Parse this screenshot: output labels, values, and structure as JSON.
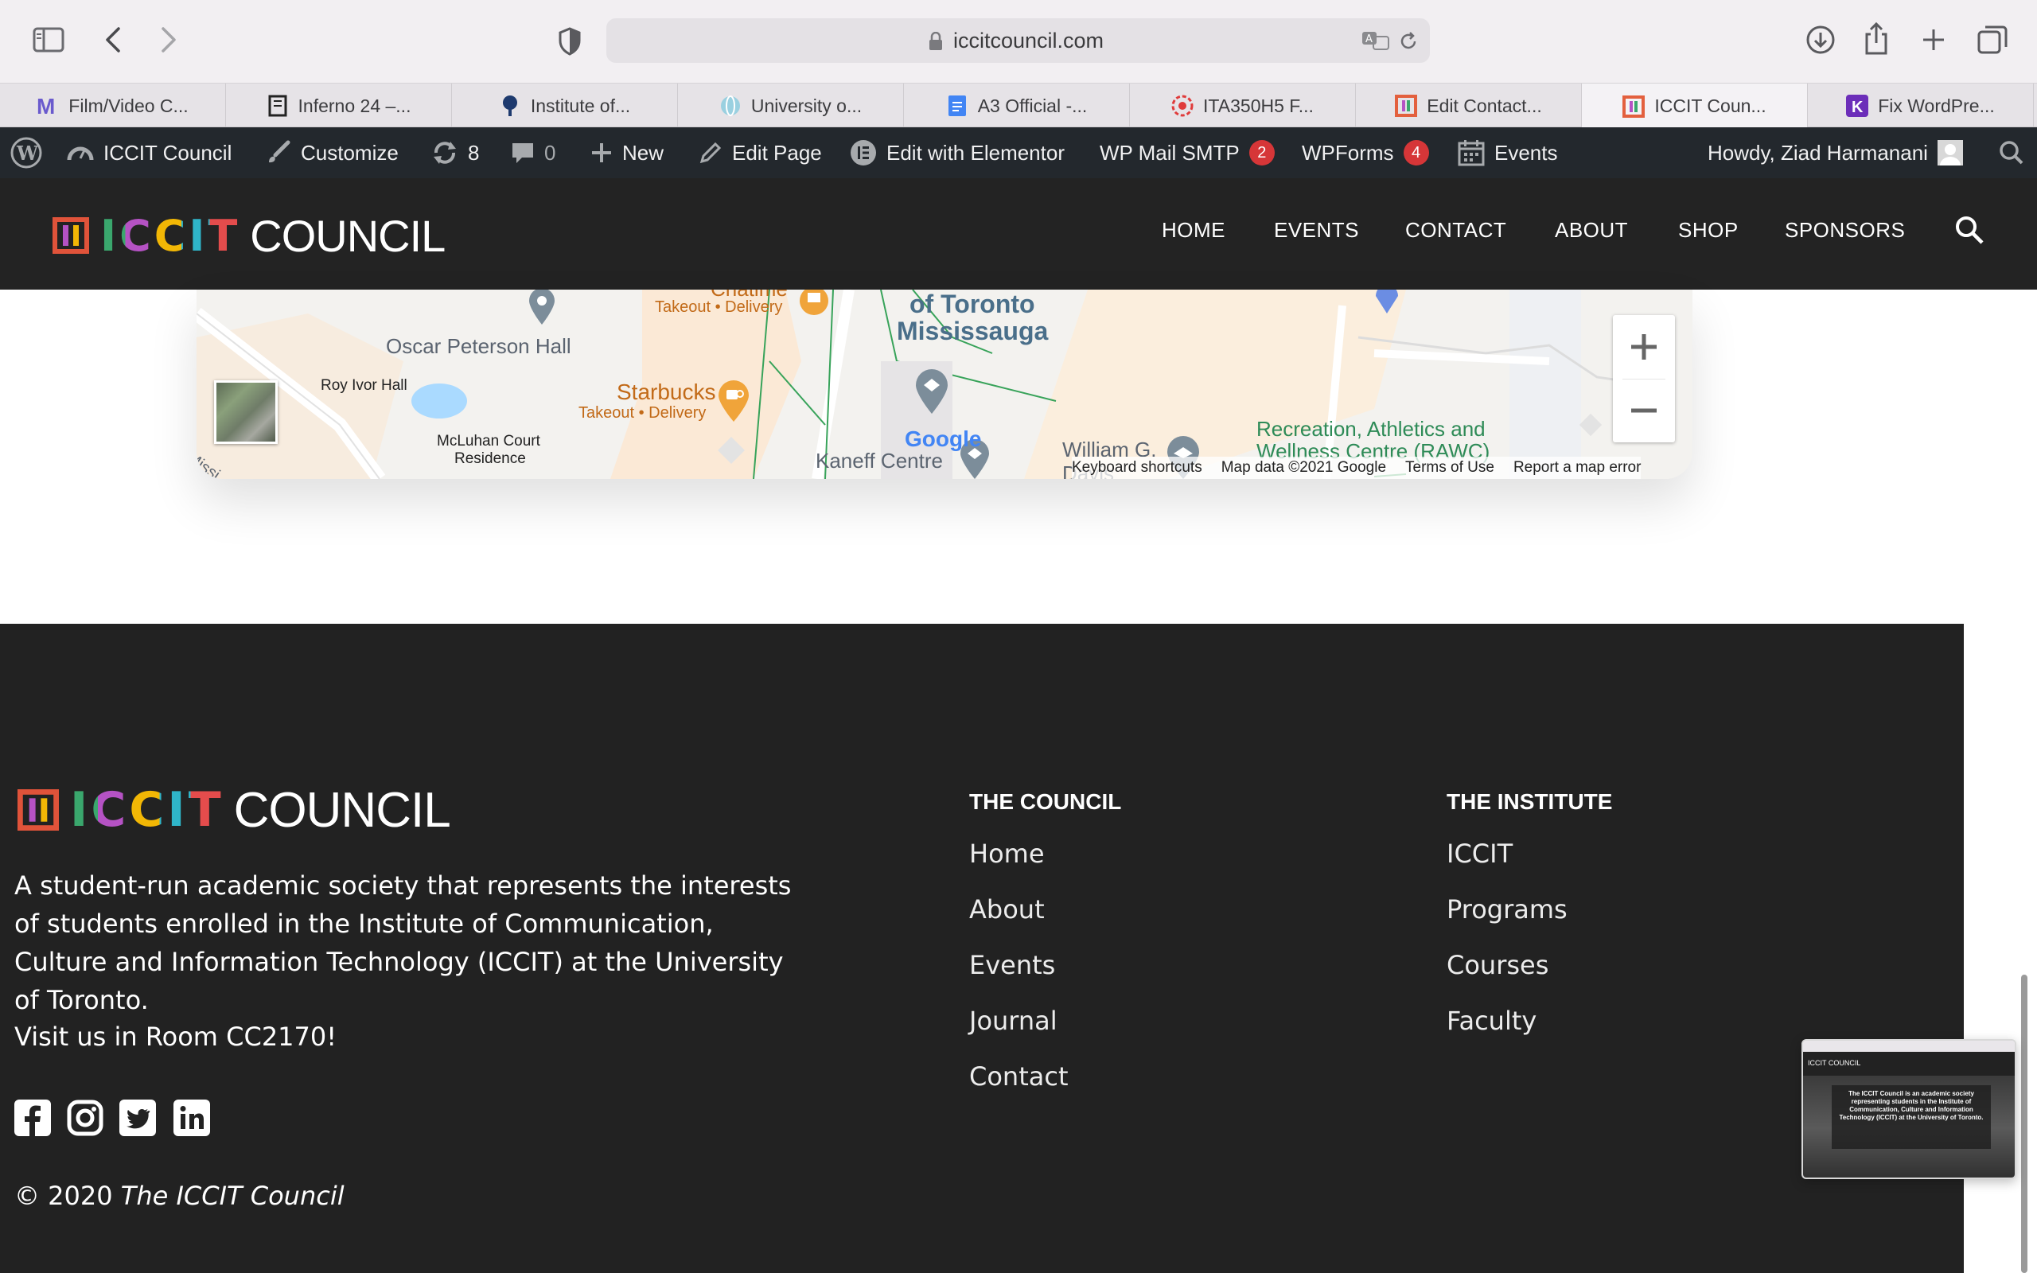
{
  "browser": {
    "url": "iccitcouncil.com",
    "tabs": [
      {
        "label": "Film/Video C...",
        "icon": "m-logo-icon",
        "color": "#6a5acd"
      },
      {
        "label": "Inferno 24 –...",
        "icon": "book-icon",
        "color": "#222222"
      },
      {
        "label": "Institute of...",
        "icon": "tree-icon",
        "color": "#1e3a6e"
      },
      {
        "label": "University o...",
        "icon": "globe-icon",
        "color": "#9ad0e0"
      },
      {
        "label": "A3 Official -...",
        "icon": "docs-icon",
        "color": "#4285f4"
      },
      {
        "label": "ITA350H5 F...",
        "icon": "gear-red-icon",
        "color": "#e03b3b"
      },
      {
        "label": "Edit Contact...",
        "icon": "iccit-icon",
        "color": "#e3603e"
      },
      {
        "label": "ICCIT Coun...",
        "icon": "iccit-icon",
        "color": "#e3603e",
        "active": true
      },
      {
        "label": "Fix WordPre...",
        "icon": "k-logo-icon",
        "color": "#6c2eb9"
      }
    ]
  },
  "wp_admin_bar": {
    "site_name": "ICCIT Council",
    "customize": "Customize",
    "updates_count": "8",
    "comments_count": "0",
    "new": "New",
    "edit_page": "Edit Page",
    "edit_elementor": "Edit with Elementor",
    "wp_mail_smtp": "WP Mail SMTP",
    "wp_mail_badge": "2",
    "wpforms": "WPForms",
    "wpforms_badge": "4",
    "events": "Events",
    "howdy": "Howdy, Ziad Harmanani"
  },
  "site": {
    "logo_block": "ICCIT",
    "logo_word": "COUNCIL",
    "nav": [
      "HOME",
      "EVENTS",
      "CONTACT",
      "ABOUT",
      "SHOP",
      "SPONSORS"
    ]
  },
  "map": {
    "labels": {
      "uni_line1": "of Toronto",
      "uni_line2": "Mississauga",
      "oscar": "Oscar Peterson Hall",
      "roy": "Roy Ivor Hall",
      "mcluhan1": "McLuhan Court",
      "mcluhan2": "Residence",
      "starbucks": "Starbucks",
      "takeout1": "Takeout • Delivery",
      "takeout2": "Takeout • Delivery",
      "chatime": "Chatime",
      "kaneff": "Kaneff Centre",
      "william": "William G.",
      "davis": "Davis",
      "rawc1": "Recreation, Athletics and",
      "rawc2": "Wellness Centre (RAWC)",
      "google": "Google",
      "missi": "Missi"
    },
    "attribution": {
      "shortcuts": "Keyboard shortcuts",
      "data": "Map data ©2021 Google",
      "terms": "Terms of Use",
      "report": "Report a map error"
    }
  },
  "footer": {
    "about": "A student-run academic society that represents the interests of students enrolled in the Institute of Communication, Culture and Information Technology (ICCIT) at the University of Toronto.",
    "visit": "Visit us in Room CC2170!",
    "copyright_prefix": "© 2020 ",
    "copyright_name": "The ICCIT Council",
    "council_heading": "THE COUNCIL",
    "council_links": [
      "Home",
      "About",
      "Events",
      "Journal",
      "Contact"
    ],
    "institute_heading": "THE INSTITUTE",
    "institute_links": [
      "ICCIT",
      "Programs",
      "Courses",
      "Faculty"
    ],
    "social": [
      "facebook-icon",
      "instagram-icon",
      "twitter-icon",
      "linkedin-icon"
    ]
  },
  "preview": {
    "heading": "ICCIT COUNCIL",
    "text": "The ICCIT Council is an academic society representing students in the Institute of Communication, Culture and Information Technology (ICCIT) at the University of Toronto."
  },
  "colors": {
    "logo": [
      "#e0533a",
      "#3aa76d",
      "#b552c4",
      "#2fb5c9",
      "#f2b705",
      "#3a7bd5",
      "#e44c4c"
    ]
  }
}
